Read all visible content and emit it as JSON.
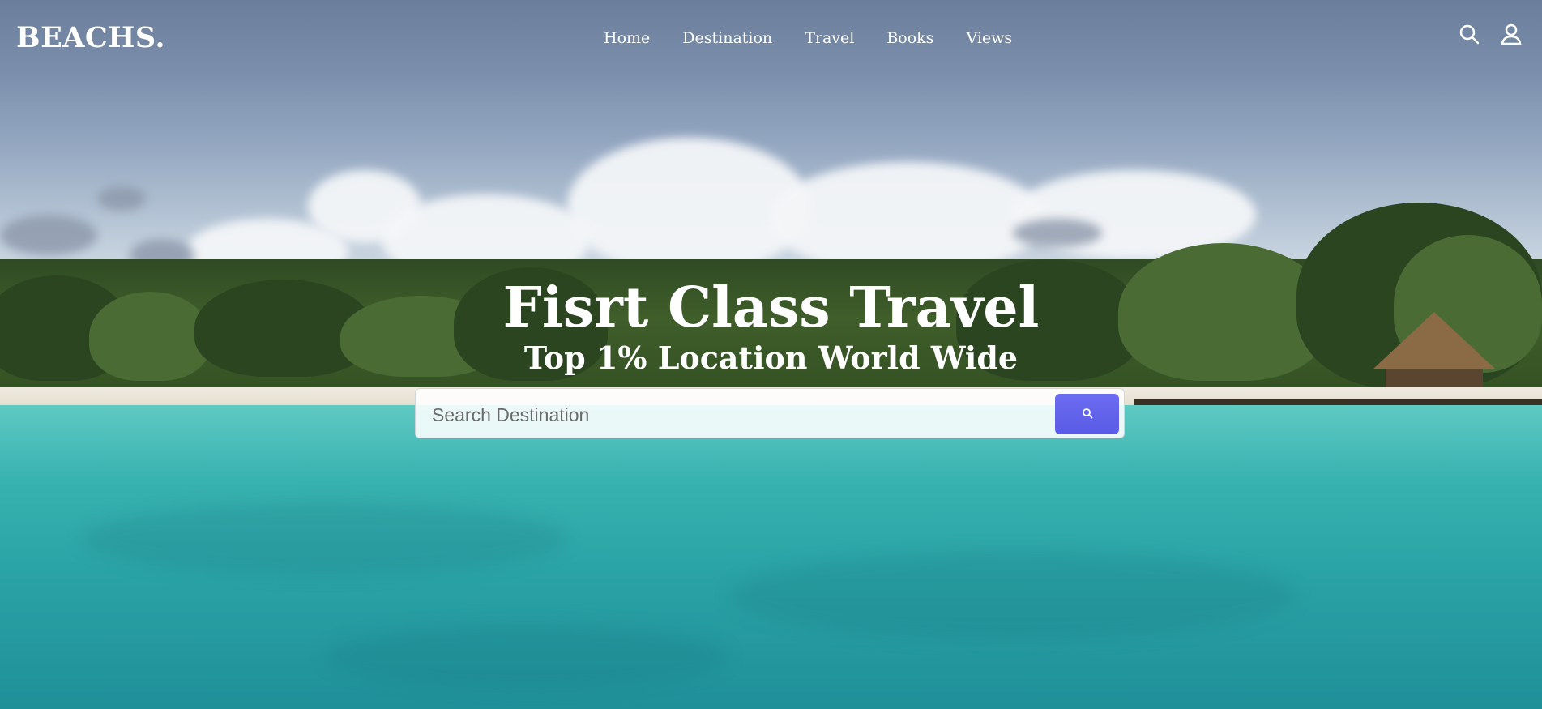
{
  "brand": {
    "logo": "BEACHS."
  },
  "nav": {
    "items": [
      {
        "label": "Home"
      },
      {
        "label": "Destination"
      },
      {
        "label": "Travel"
      },
      {
        "label": "Books"
      },
      {
        "label": "Views"
      }
    ],
    "icons": [
      "search-icon",
      "user-icon"
    ]
  },
  "hero": {
    "title": "Fisrt Class Travel",
    "subtitle": "Top 1% Location World Wide"
  },
  "search": {
    "placeholder": "Search Destination",
    "button_icon": "search-icon"
  },
  "colors": {
    "accent": "#5f60ec",
    "text": "#ffffff"
  }
}
